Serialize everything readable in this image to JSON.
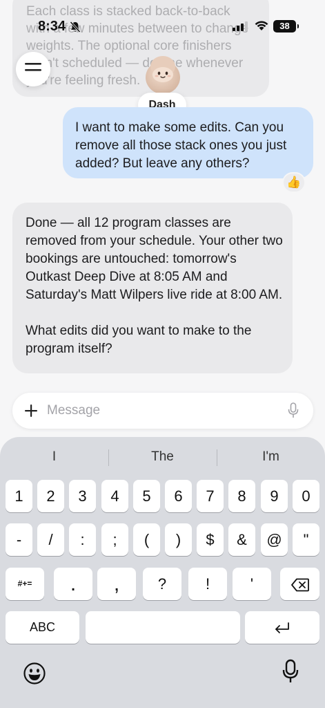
{
  "status_bar": {
    "time": "8:34",
    "battery": "38"
  },
  "previous_message": {
    "text": "Each class is stacked back-to-back with a few minutes between to change weights. The optional core finishers aren't scheduled — do one whenever you're feeling fresh."
  },
  "header": {
    "assistant_name": "Dash"
  },
  "messages": {
    "user": "I want to make some edits. Can you remove all those stack ones you just added? But leave any others?",
    "reaction": "👍",
    "assistant_p1": "Done — all 12 program classes are removed from your schedule. Your other two bookings are untouched: tomorrow's Outkast Deep Dive at 8:05 AM and Saturday's Matt Wilpers live ride at 8:00 AM.",
    "assistant_p2": "What edits did you want to make to the program itself?"
  },
  "composer": {
    "placeholder": "Message"
  },
  "keyboard": {
    "suggestions": [
      "I",
      "The",
      "I'm"
    ],
    "row1": [
      "1",
      "2",
      "3",
      "4",
      "5",
      "6",
      "7",
      "8",
      "9",
      "0"
    ],
    "row2": [
      "-",
      "/",
      ":",
      ";",
      "(",
      ")",
      "$",
      "&",
      "@",
      "\""
    ],
    "row3_mode": "#+=",
    "row3": [
      ".",
      ",",
      "?",
      "!",
      "'"
    ],
    "abc_label": "ABC"
  },
  "colors": {
    "user_bubble": "#cfe3fb",
    "assistant_bubble": "#e9e9eb",
    "keyboard_bg": "#d9dbe0"
  }
}
